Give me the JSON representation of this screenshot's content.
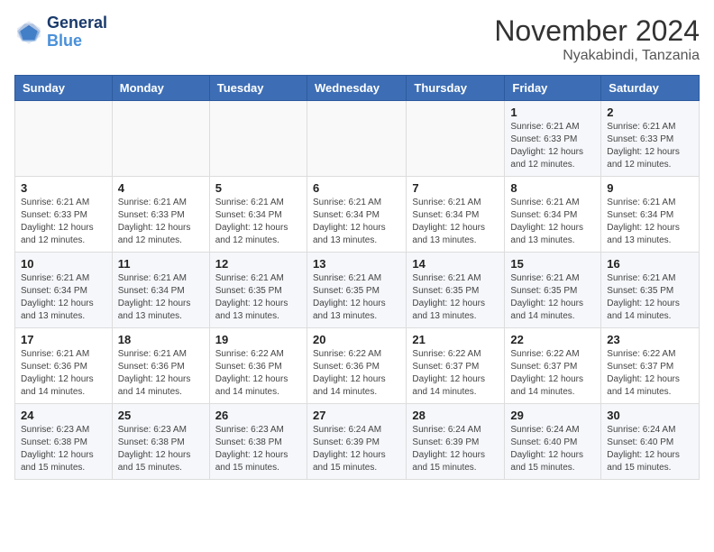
{
  "logo": {
    "line1": "General",
    "line2": "Blue"
  },
  "title": "November 2024",
  "location": "Nyakabindi, Tanzania",
  "weekdays": [
    "Sunday",
    "Monday",
    "Tuesday",
    "Wednesday",
    "Thursday",
    "Friday",
    "Saturday"
  ],
  "weeks": [
    [
      {
        "day": "",
        "info": ""
      },
      {
        "day": "",
        "info": ""
      },
      {
        "day": "",
        "info": ""
      },
      {
        "day": "",
        "info": ""
      },
      {
        "day": "",
        "info": ""
      },
      {
        "day": "1",
        "info": "Sunrise: 6:21 AM\nSunset: 6:33 PM\nDaylight: 12 hours\nand 12 minutes."
      },
      {
        "day": "2",
        "info": "Sunrise: 6:21 AM\nSunset: 6:33 PM\nDaylight: 12 hours\nand 12 minutes."
      }
    ],
    [
      {
        "day": "3",
        "info": "Sunrise: 6:21 AM\nSunset: 6:33 PM\nDaylight: 12 hours\nand 12 minutes."
      },
      {
        "day": "4",
        "info": "Sunrise: 6:21 AM\nSunset: 6:33 PM\nDaylight: 12 hours\nand 12 minutes."
      },
      {
        "day": "5",
        "info": "Sunrise: 6:21 AM\nSunset: 6:34 PM\nDaylight: 12 hours\nand 12 minutes."
      },
      {
        "day": "6",
        "info": "Sunrise: 6:21 AM\nSunset: 6:34 PM\nDaylight: 12 hours\nand 13 minutes."
      },
      {
        "day": "7",
        "info": "Sunrise: 6:21 AM\nSunset: 6:34 PM\nDaylight: 12 hours\nand 13 minutes."
      },
      {
        "day": "8",
        "info": "Sunrise: 6:21 AM\nSunset: 6:34 PM\nDaylight: 12 hours\nand 13 minutes."
      },
      {
        "day": "9",
        "info": "Sunrise: 6:21 AM\nSunset: 6:34 PM\nDaylight: 12 hours\nand 13 minutes."
      }
    ],
    [
      {
        "day": "10",
        "info": "Sunrise: 6:21 AM\nSunset: 6:34 PM\nDaylight: 12 hours\nand 13 minutes."
      },
      {
        "day": "11",
        "info": "Sunrise: 6:21 AM\nSunset: 6:34 PM\nDaylight: 12 hours\nand 13 minutes."
      },
      {
        "day": "12",
        "info": "Sunrise: 6:21 AM\nSunset: 6:35 PM\nDaylight: 12 hours\nand 13 minutes."
      },
      {
        "day": "13",
        "info": "Sunrise: 6:21 AM\nSunset: 6:35 PM\nDaylight: 12 hours\nand 13 minutes."
      },
      {
        "day": "14",
        "info": "Sunrise: 6:21 AM\nSunset: 6:35 PM\nDaylight: 12 hours\nand 13 minutes."
      },
      {
        "day": "15",
        "info": "Sunrise: 6:21 AM\nSunset: 6:35 PM\nDaylight: 12 hours\nand 14 minutes."
      },
      {
        "day": "16",
        "info": "Sunrise: 6:21 AM\nSunset: 6:35 PM\nDaylight: 12 hours\nand 14 minutes."
      }
    ],
    [
      {
        "day": "17",
        "info": "Sunrise: 6:21 AM\nSunset: 6:36 PM\nDaylight: 12 hours\nand 14 minutes."
      },
      {
        "day": "18",
        "info": "Sunrise: 6:21 AM\nSunset: 6:36 PM\nDaylight: 12 hours\nand 14 minutes."
      },
      {
        "day": "19",
        "info": "Sunrise: 6:22 AM\nSunset: 6:36 PM\nDaylight: 12 hours\nand 14 minutes."
      },
      {
        "day": "20",
        "info": "Sunrise: 6:22 AM\nSunset: 6:36 PM\nDaylight: 12 hours\nand 14 minutes."
      },
      {
        "day": "21",
        "info": "Sunrise: 6:22 AM\nSunset: 6:37 PM\nDaylight: 12 hours\nand 14 minutes."
      },
      {
        "day": "22",
        "info": "Sunrise: 6:22 AM\nSunset: 6:37 PM\nDaylight: 12 hours\nand 14 minutes."
      },
      {
        "day": "23",
        "info": "Sunrise: 6:22 AM\nSunset: 6:37 PM\nDaylight: 12 hours\nand 14 minutes."
      }
    ],
    [
      {
        "day": "24",
        "info": "Sunrise: 6:23 AM\nSunset: 6:38 PM\nDaylight: 12 hours\nand 15 minutes."
      },
      {
        "day": "25",
        "info": "Sunrise: 6:23 AM\nSunset: 6:38 PM\nDaylight: 12 hours\nand 15 minutes."
      },
      {
        "day": "26",
        "info": "Sunrise: 6:23 AM\nSunset: 6:38 PM\nDaylight: 12 hours\nand 15 minutes."
      },
      {
        "day": "27",
        "info": "Sunrise: 6:24 AM\nSunset: 6:39 PM\nDaylight: 12 hours\nand 15 minutes."
      },
      {
        "day": "28",
        "info": "Sunrise: 6:24 AM\nSunset: 6:39 PM\nDaylight: 12 hours\nand 15 minutes."
      },
      {
        "day": "29",
        "info": "Sunrise: 6:24 AM\nSunset: 6:40 PM\nDaylight: 12 hours\nand 15 minutes."
      },
      {
        "day": "30",
        "info": "Sunrise: 6:24 AM\nSunset: 6:40 PM\nDaylight: 12 hours\nand 15 minutes."
      }
    ]
  ]
}
